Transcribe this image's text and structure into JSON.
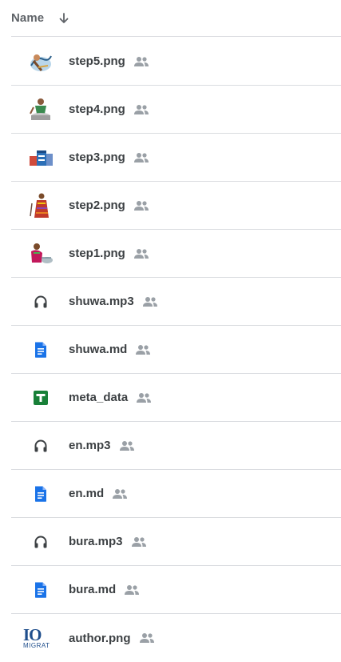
{
  "header": {
    "name_label": "Name",
    "sort_icon": "arrow-down-icon"
  },
  "files": [
    {
      "name": "step5.png",
      "type": "image",
      "icon": "image-thumbnail",
      "shared": true
    },
    {
      "name": "step4.png",
      "type": "image",
      "icon": "image-thumbnail",
      "shared": true
    },
    {
      "name": "step3.png",
      "type": "image",
      "icon": "image-thumbnail",
      "shared": true
    },
    {
      "name": "step2.png",
      "type": "image",
      "icon": "image-thumbnail",
      "shared": true
    },
    {
      "name": "step1.png",
      "type": "image",
      "icon": "image-thumbnail",
      "shared": true
    },
    {
      "name": "shuwa.mp3",
      "type": "audio",
      "icon": "headphones-icon",
      "shared": true
    },
    {
      "name": "shuwa.md",
      "type": "doc",
      "icon": "document-icon",
      "shared": true
    },
    {
      "name": "meta_data",
      "type": "sheet",
      "icon": "spreadsheet-icon",
      "shared": true
    },
    {
      "name": "en.mp3",
      "type": "audio",
      "icon": "headphones-icon",
      "shared": true
    },
    {
      "name": "en.md",
      "type": "doc",
      "icon": "document-icon",
      "shared": true
    },
    {
      "name": "bura.mp3",
      "type": "audio",
      "icon": "headphones-icon",
      "shared": true
    },
    {
      "name": "bura.md",
      "type": "doc",
      "icon": "document-icon",
      "shared": true
    },
    {
      "name": "author.png",
      "type": "image",
      "icon": "image-thumbnail",
      "shared": true,
      "thumb_text": {
        "big": "IO",
        "small": "MIGRAT"
      }
    }
  ],
  "colors": {
    "doc_blue": "#1a73e8",
    "sheet_green": "#188038",
    "text": "#3c4043",
    "muted": "#5f6368",
    "shared_gray": "#9aa0a6",
    "divider": "#dadce0"
  }
}
